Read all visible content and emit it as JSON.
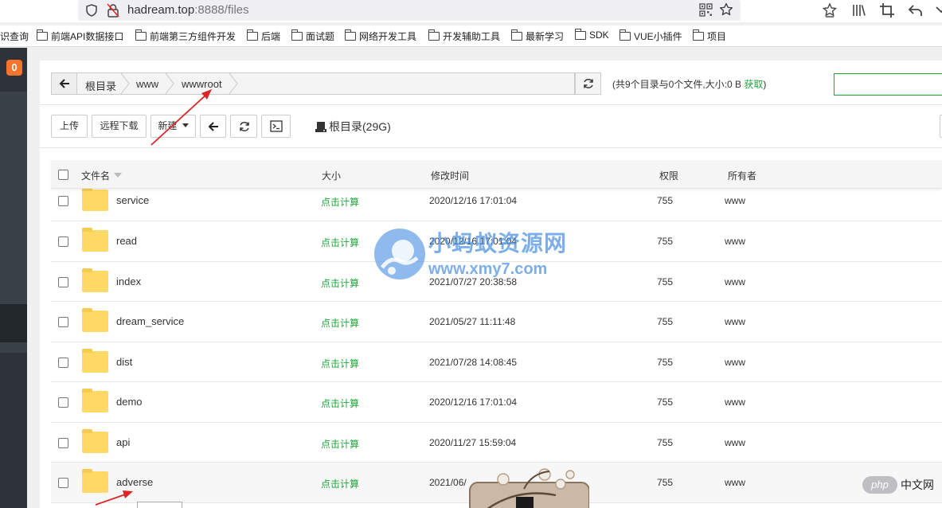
{
  "browser": {
    "url_host": "hadream.top",
    "url_rest": ":8888/files",
    "bookmarks": [
      "识查询",
      "前端API数据接口",
      "前端第三方组件开发",
      "后端",
      "面试题",
      "网络开发工具",
      "开发辅助工具",
      "最新学习",
      "SDK",
      "VUE小插件",
      "项目"
    ]
  },
  "sidebar": {
    "badge": "0"
  },
  "pathbar": {
    "crumbs": [
      "根目录",
      "www",
      "wwwroot"
    ],
    "summary_text": "(共9个目录与0个文件,大小:0 B ",
    "summary_link": "获取",
    "summary_close": ")"
  },
  "toolbar": {
    "upload": "上传",
    "remote_download": "远程下载",
    "new": "新建",
    "disk_label": "根目录(29G)"
  },
  "table": {
    "headers": {
      "name": "文件名",
      "size": "大小",
      "mtime": "修改时间",
      "perm": "权限",
      "owner": "所有者"
    },
    "rows": [
      {
        "name": "service",
        "size": "点击计算",
        "mtime": "2020/12/16 17:01:04",
        "perm": "755",
        "owner": "www"
      },
      {
        "name": "read",
        "size": "点击计算",
        "mtime": "2020/12/16 17:01:04",
        "perm": "755",
        "owner": "www"
      },
      {
        "name": "index",
        "size": "点击计算",
        "mtime": "2021/07/27 20:38:58",
        "perm": "755",
        "owner": "www"
      },
      {
        "name": "dream_service",
        "size": "点击计算",
        "mtime": "2021/05/27 11:11:48",
        "perm": "755",
        "owner": "www"
      },
      {
        "name": "dist",
        "size": "点击计算",
        "mtime": "2021/07/28 14:08:45",
        "perm": "755",
        "owner": "www"
      },
      {
        "name": "demo",
        "size": "点击计算",
        "mtime": "2020/12/16 17:01:04",
        "perm": "755",
        "owner": "www"
      },
      {
        "name": "api",
        "size": "点击计算",
        "mtime": "2020/11/27 15:59:04",
        "perm": "755",
        "owner": "www"
      },
      {
        "name": "adverse",
        "size": "点击计算",
        "mtime": "2021/06/",
        "perm": "755",
        "owner": "www"
      }
    ]
  },
  "watermark": {
    "title": "小蚂蚁资源网",
    "url": "www.xmy7.com",
    "php_badge": "php",
    "php_text": "中文网"
  },
  "colors": {
    "accent_green": "#20a53a",
    "sidebar_dark": "#2d3339",
    "badge_orange": "#f7742d",
    "folder_yellow": "#ffd966",
    "annotation_red": "#d92626"
  }
}
